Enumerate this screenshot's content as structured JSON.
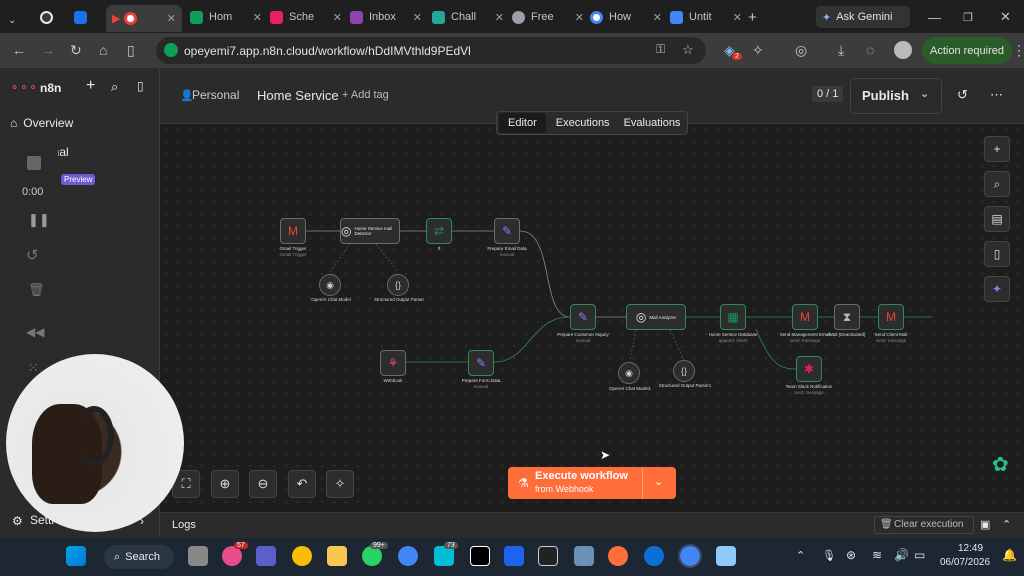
{
  "browser": {
    "tabs": [
      {
        "title": "",
        "color": "#e8e8e8"
      },
      {
        "title": "",
        "color": "#1a73e8"
      },
      {
        "title": "",
        "color": "#ea4335"
      },
      {
        "title": "Hom",
        "color": "#0f9d58"
      },
      {
        "title": "Sche",
        "color": "#e91e63"
      },
      {
        "title": "Inbox",
        "color": "#8e44ad"
      },
      {
        "title": "Chall",
        "color": "#26a69a"
      },
      {
        "title": "Free",
        "color": "#9aa0a6"
      },
      {
        "title": "How",
        "color": "#4285f4"
      },
      {
        "title": "Untit",
        "color": "#4285f4"
      }
    ],
    "ask_gemini": "Ask Gemini",
    "url": "opeyemi7.app.n8n.cloud/workflow/hDdIMVthld9PEdVl",
    "action_required": "Action required",
    "ext_badge": "2"
  },
  "sidebar": {
    "brand": "n8n",
    "items": [
      {
        "label": "Overview"
      },
      {
        "label": "onal"
      }
    ],
    "preview_badge": "Preview",
    "recorder_time": "0:00",
    "settings": "Setti"
  },
  "header": {
    "breadcrumb_personal": "Personal",
    "workflow_name": "Home Service",
    "add_tag": "+ Add tag",
    "counter": "0 / 1",
    "publish": "Publish",
    "tabs": [
      "Editor",
      "Executions",
      "Evaluations"
    ]
  },
  "nodes": [
    {
      "id": "gmail",
      "label": "Gmail Trigger",
      "sub": "Gmail Trigger",
      "icon": "M"
    },
    {
      "id": "detector",
      "label": "Home Service mail Detector",
      "sub": "",
      "icon": "◎"
    },
    {
      "id": "if",
      "label": "If",
      "sub": "",
      "icon": "⇄"
    },
    {
      "id": "prep_email",
      "label": "Prepare Email Data",
      "sub": "manual",
      "icon": "✎"
    },
    {
      "id": "openai1",
      "label": "OpenAI Chat Model",
      "sub": "",
      "icon": "◉"
    },
    {
      "id": "parser1",
      "label": "Structured Output Parser",
      "sub": "",
      "icon": "{}"
    },
    {
      "id": "prep_inquiry",
      "label": "Prepare Customer Inquiry",
      "sub": "manual",
      "icon": "✎"
    },
    {
      "id": "mail_analyzer",
      "label": "Mail Analyzer",
      "sub": "",
      "icon": "◎"
    },
    {
      "id": "db",
      "label": "Home Service Database",
      "sub": "append: sheet",
      "icon": "▦"
    },
    {
      "id": "send_mgmt",
      "label": "Send Management Email",
      "sub": "send: message",
      "icon": "M"
    },
    {
      "id": "wait",
      "label": "Wait (Deactivated)",
      "sub": "",
      "icon": "⧗"
    },
    {
      "id": "send_client",
      "label": "Send Client Mail",
      "sub": "send: message",
      "icon": "M"
    },
    {
      "id": "slack",
      "label": "Team Slack Notification",
      "sub": "post: message",
      "icon": "✱"
    },
    {
      "id": "openai2",
      "label": "OpenAI Chat Model1",
      "sub": "",
      "icon": "◉"
    },
    {
      "id": "parser2",
      "label": "Structured Output Parser1",
      "sub": "",
      "icon": "{}"
    },
    {
      "id": "webhook",
      "label": "Webhook",
      "sub": "",
      "icon": "⚘"
    },
    {
      "id": "prep_form",
      "label": "Prepare Form Data",
      "sub": "manual",
      "icon": "✎"
    }
  ],
  "execute": {
    "label": "Execute workflow",
    "sub": "from Webhook"
  },
  "logs": {
    "label": "Logs",
    "clear": "Clear execution"
  },
  "taskbar": {
    "search": "Search",
    "time": "12:49",
    "date": "06/07/2026",
    "badge_whatsapp": "99+",
    "badge_teams": "57",
    "badge_73": "73"
  }
}
